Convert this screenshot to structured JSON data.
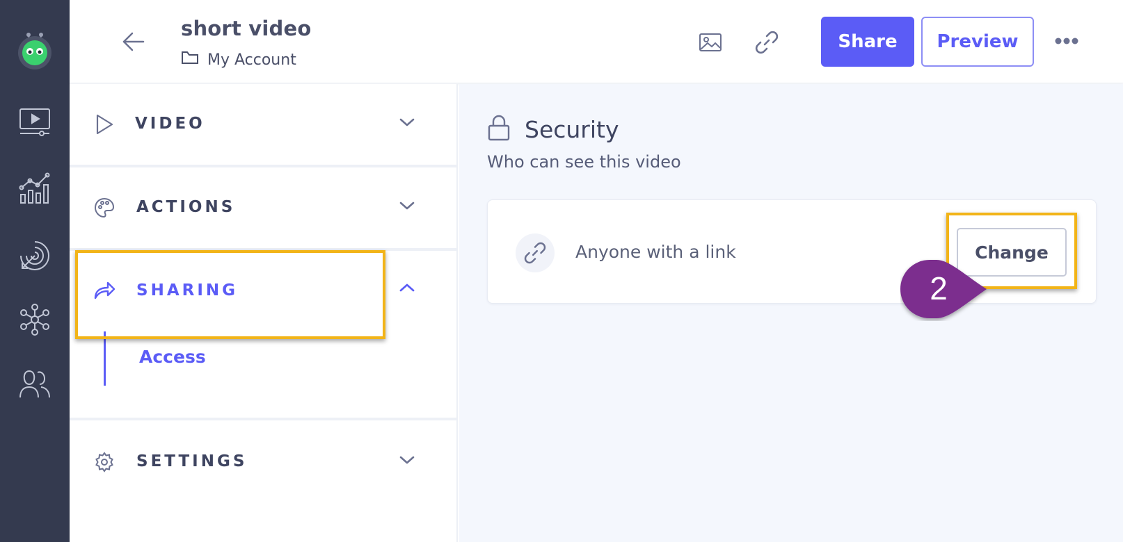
{
  "header": {
    "title": "short video",
    "breadcrumb": "My Account",
    "share_label": "Share",
    "preview_label": "Preview"
  },
  "rail": {
    "icons": [
      "robot-logo-icon",
      "video-library-icon",
      "analytics-icon",
      "target-icon",
      "integrations-icon",
      "contacts-icon"
    ]
  },
  "panel": {
    "sections": [
      {
        "label": "VIDEO",
        "icon": "play-icon",
        "expanded": false
      },
      {
        "label": "ACTIONS",
        "icon": "palette-icon",
        "expanded": false
      },
      {
        "label": "SHARING",
        "icon": "share-arrow-icon",
        "expanded": true,
        "sub_items": [
          "Access"
        ]
      },
      {
        "label": "SETTINGS",
        "icon": "gear-icon",
        "expanded": false
      }
    ]
  },
  "main": {
    "section_title": "Security",
    "section_subtitle": "Who can see this video",
    "access_option": "Anyone with a link",
    "change_label": "Change"
  },
  "annotation": {
    "step": "2",
    "highlight_color": "#f2b418",
    "badge_color": "#7b2e8e"
  },
  "colors": {
    "accent": "#5b5cf6",
    "rail": "#343a4f",
    "content_bg": "#f4f7fd"
  }
}
